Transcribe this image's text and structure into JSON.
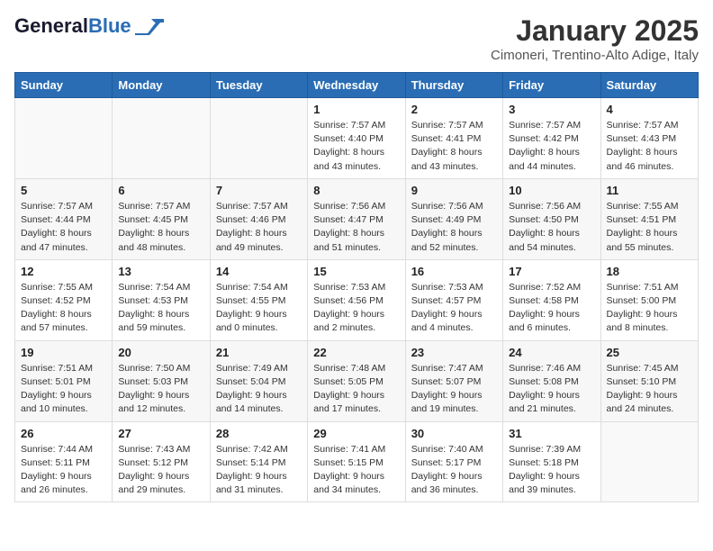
{
  "header": {
    "logo_line1": "General",
    "logo_line2": "Blue",
    "month": "January 2025",
    "location": "Cimoneri, Trentino-Alto Adige, Italy"
  },
  "weekdays": [
    "Sunday",
    "Monday",
    "Tuesday",
    "Wednesday",
    "Thursday",
    "Friday",
    "Saturday"
  ],
  "weeks": [
    [
      {
        "day": "",
        "info": ""
      },
      {
        "day": "",
        "info": ""
      },
      {
        "day": "",
        "info": ""
      },
      {
        "day": "1",
        "info": "Sunrise: 7:57 AM\nSunset: 4:40 PM\nDaylight: 8 hours\nand 43 minutes."
      },
      {
        "day": "2",
        "info": "Sunrise: 7:57 AM\nSunset: 4:41 PM\nDaylight: 8 hours\nand 43 minutes."
      },
      {
        "day": "3",
        "info": "Sunrise: 7:57 AM\nSunset: 4:42 PM\nDaylight: 8 hours\nand 44 minutes."
      },
      {
        "day": "4",
        "info": "Sunrise: 7:57 AM\nSunset: 4:43 PM\nDaylight: 8 hours\nand 46 minutes."
      }
    ],
    [
      {
        "day": "5",
        "info": "Sunrise: 7:57 AM\nSunset: 4:44 PM\nDaylight: 8 hours\nand 47 minutes."
      },
      {
        "day": "6",
        "info": "Sunrise: 7:57 AM\nSunset: 4:45 PM\nDaylight: 8 hours\nand 48 minutes."
      },
      {
        "day": "7",
        "info": "Sunrise: 7:57 AM\nSunset: 4:46 PM\nDaylight: 8 hours\nand 49 minutes."
      },
      {
        "day": "8",
        "info": "Sunrise: 7:56 AM\nSunset: 4:47 PM\nDaylight: 8 hours\nand 51 minutes."
      },
      {
        "day": "9",
        "info": "Sunrise: 7:56 AM\nSunset: 4:49 PM\nDaylight: 8 hours\nand 52 minutes."
      },
      {
        "day": "10",
        "info": "Sunrise: 7:56 AM\nSunset: 4:50 PM\nDaylight: 8 hours\nand 54 minutes."
      },
      {
        "day": "11",
        "info": "Sunrise: 7:55 AM\nSunset: 4:51 PM\nDaylight: 8 hours\nand 55 minutes."
      }
    ],
    [
      {
        "day": "12",
        "info": "Sunrise: 7:55 AM\nSunset: 4:52 PM\nDaylight: 8 hours\nand 57 minutes."
      },
      {
        "day": "13",
        "info": "Sunrise: 7:54 AM\nSunset: 4:53 PM\nDaylight: 8 hours\nand 59 minutes."
      },
      {
        "day": "14",
        "info": "Sunrise: 7:54 AM\nSunset: 4:55 PM\nDaylight: 9 hours\nand 0 minutes."
      },
      {
        "day": "15",
        "info": "Sunrise: 7:53 AM\nSunset: 4:56 PM\nDaylight: 9 hours\nand 2 minutes."
      },
      {
        "day": "16",
        "info": "Sunrise: 7:53 AM\nSunset: 4:57 PM\nDaylight: 9 hours\nand 4 minutes."
      },
      {
        "day": "17",
        "info": "Sunrise: 7:52 AM\nSunset: 4:58 PM\nDaylight: 9 hours\nand 6 minutes."
      },
      {
        "day": "18",
        "info": "Sunrise: 7:51 AM\nSunset: 5:00 PM\nDaylight: 9 hours\nand 8 minutes."
      }
    ],
    [
      {
        "day": "19",
        "info": "Sunrise: 7:51 AM\nSunset: 5:01 PM\nDaylight: 9 hours\nand 10 minutes."
      },
      {
        "day": "20",
        "info": "Sunrise: 7:50 AM\nSunset: 5:03 PM\nDaylight: 9 hours\nand 12 minutes."
      },
      {
        "day": "21",
        "info": "Sunrise: 7:49 AM\nSunset: 5:04 PM\nDaylight: 9 hours\nand 14 minutes."
      },
      {
        "day": "22",
        "info": "Sunrise: 7:48 AM\nSunset: 5:05 PM\nDaylight: 9 hours\nand 17 minutes."
      },
      {
        "day": "23",
        "info": "Sunrise: 7:47 AM\nSunset: 5:07 PM\nDaylight: 9 hours\nand 19 minutes."
      },
      {
        "day": "24",
        "info": "Sunrise: 7:46 AM\nSunset: 5:08 PM\nDaylight: 9 hours\nand 21 minutes."
      },
      {
        "day": "25",
        "info": "Sunrise: 7:45 AM\nSunset: 5:10 PM\nDaylight: 9 hours\nand 24 minutes."
      }
    ],
    [
      {
        "day": "26",
        "info": "Sunrise: 7:44 AM\nSunset: 5:11 PM\nDaylight: 9 hours\nand 26 minutes."
      },
      {
        "day": "27",
        "info": "Sunrise: 7:43 AM\nSunset: 5:12 PM\nDaylight: 9 hours\nand 29 minutes."
      },
      {
        "day": "28",
        "info": "Sunrise: 7:42 AM\nSunset: 5:14 PM\nDaylight: 9 hours\nand 31 minutes."
      },
      {
        "day": "29",
        "info": "Sunrise: 7:41 AM\nSunset: 5:15 PM\nDaylight: 9 hours\nand 34 minutes."
      },
      {
        "day": "30",
        "info": "Sunrise: 7:40 AM\nSunset: 5:17 PM\nDaylight: 9 hours\nand 36 minutes."
      },
      {
        "day": "31",
        "info": "Sunrise: 7:39 AM\nSunset: 5:18 PM\nDaylight: 9 hours\nand 39 minutes."
      },
      {
        "day": "",
        "info": ""
      }
    ]
  ]
}
